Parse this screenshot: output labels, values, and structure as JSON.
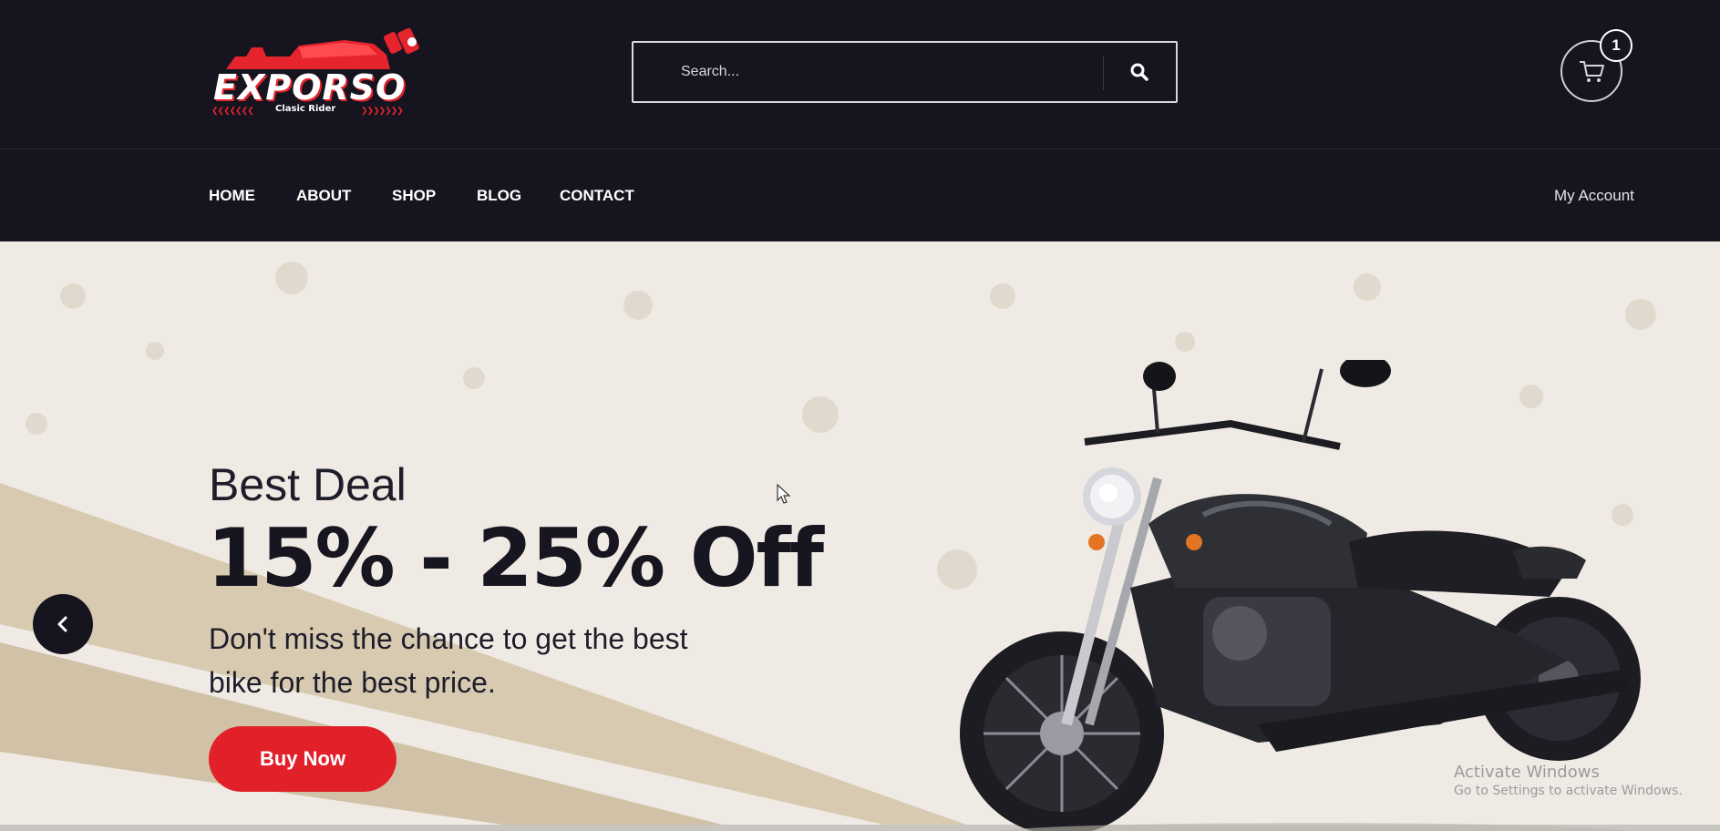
{
  "brand": {
    "name": "EXPORSO",
    "tagline": "Clasic Rider",
    "accent_color": "#e6242d",
    "header_bg": "#15141f"
  },
  "search": {
    "placeholder": "Search...",
    "icon": "search-icon"
  },
  "cart": {
    "icon": "cart-icon",
    "count": "1"
  },
  "nav": {
    "items": [
      {
        "label": "HOME"
      },
      {
        "label": "ABOUT"
      },
      {
        "label": "SHOP"
      },
      {
        "label": "BLOG"
      },
      {
        "label": "CONTACT"
      }
    ],
    "account_label": "My Account"
  },
  "hero": {
    "eyebrow": "Best Deal",
    "headline": "15% - 25% Off",
    "subtext": "Don't miss the chance to get the best bike for the best price.",
    "cta_label": "Buy Now",
    "cta_color": "#e2202a",
    "prev_icon": "chevron-left-icon",
    "image": "motorcycle"
  },
  "os_watermark": {
    "title": "Activate Windows",
    "subtitle": "Go to Settings to activate Windows."
  }
}
